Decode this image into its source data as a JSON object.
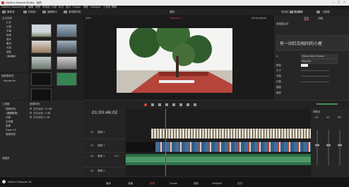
{
  "titlebar": {
    "app_title": "DaVinci Resolve Studio - 我的"
  },
  "menubar": {
    "items": [
      "DaVinci Resolve",
      "文件",
      "编辑",
      "修剪",
      "时间线",
      "片段",
      "标记",
      "显示",
      "Fusion",
      "调色",
      "Fairlight",
      "工作区",
      "帮助"
    ]
  },
  "toolbar": {
    "media_pool": "媒体池",
    "effects": "特效库",
    "edit_index": "编辑索引",
    "sound_library": "音响素材库",
    "project_name": "我的",
    "timeline_name": "时间线 - 片尾 4秒",
    "inspector": "检查器",
    "metadata": "元数据"
  },
  "viewer": {
    "zoom": "33%",
    "clip_label": "Timeline 1",
    "timecode": "00:00:46:02"
  },
  "timeline": {
    "timecode": "01:00:46:02",
    "tracks": [
      {
        "id": "V2",
        "name": "视频 2"
      },
      {
        "id": "V1",
        "name": "视频 1"
      },
      {
        "id": "A1",
        "name": "音频 1",
        "channels": "2.0"
      },
      {
        "id": "A2",
        "name": "音频 2"
      }
    ]
  },
  "media_pool": {
    "bins": [
      "主文件夹",
      "片头",
      "片尾",
      "字幕",
      "转场",
      "音乐",
      "素材",
      "光效",
      "调色",
      "Audio"
    ],
    "left_sections": [
      "媒体池",
      "工具箱",
      "视频转场",
      "音频转场",
      "字幕",
      "生成器",
      "效果"
    ],
    "sidebar_title": "智能媒体夹",
    "sidebar_item": "Keywords"
  },
  "effects_panel": {
    "title": "工具箱",
    "categories": [
      "视频转场",
      "音频转场",
      "字幕",
      "生成器",
      "效果",
      "Open FX",
      "音频特效"
    ],
    "list_title": "音频转场",
    "list_items": [
      "交叉淡化 +3 dB",
      "交叉淡化 -3 dB",
      "交叉淡化 0 dB"
    ],
    "favorites": "收藏夹"
  },
  "inspector": {
    "tabs": [
      "文本",
      "动画"
    ],
    "section": "多信息文字",
    "preview_text": "有一间红白相间的小屋",
    "font_family": "Times New Roman",
    "font_style": "Regular",
    "color_label": "颜色",
    "size_label": "大小",
    "fields": [
      "大小",
      "字距",
      "行距",
      "缩放",
      "旋转"
    ]
  },
  "mixer": {
    "title": "调音台",
    "channels": [
      "A1",
      "A2",
      "M1"
    ]
  },
  "bottom_bar": {
    "app_name": "DaVinci Resolve 16",
    "pages": [
      "媒体",
      "快编",
      "剪辑",
      "Fusion",
      "调色",
      "Fairlight",
      "交付"
    ]
  },
  "colors": {
    "accent": "#e0403f",
    "audio_green": "#3d8f5a",
    "video_blue": "#3e6f9c",
    "playhead": "#ff3b3b"
  }
}
